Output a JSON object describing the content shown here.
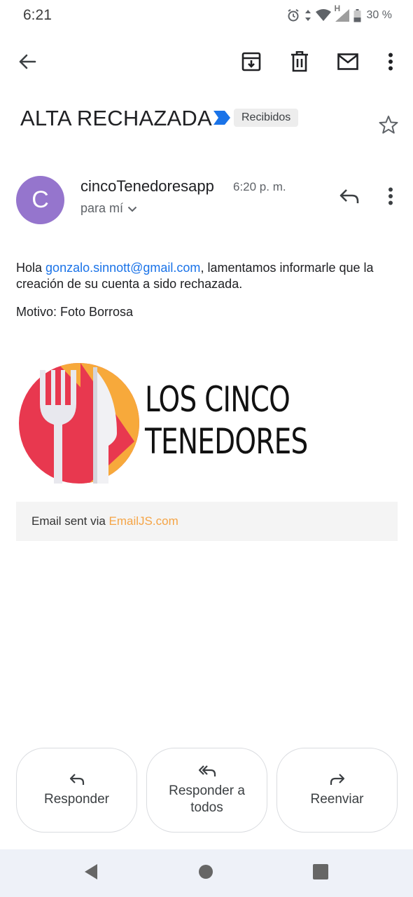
{
  "status_bar": {
    "time": "6:21",
    "network_label": "H",
    "battery_text": "30 %"
  },
  "app_bar": {
    "icons": [
      "back-arrow-icon",
      "archive-icon",
      "trash-icon",
      "mail-icon",
      "more-vert-icon"
    ]
  },
  "email": {
    "subject": "ALTA RECHAZADA",
    "label": "Recibidos",
    "sender": {
      "avatar_initial": "C",
      "avatar_color": "#9575cd",
      "name": "cincoTenedoresapp",
      "time": "6:20 p. m.",
      "recipient": "para mí"
    },
    "body": {
      "greeting": "Hola",
      "email_link": "gonzalo.sinnott@gmail.com",
      "message": ", lamentamos informarle que la creación de su cuenta a sido rechazada.",
      "reason": "Motivo: Foto Borrosa"
    },
    "logo": {
      "line1": "LOS CINCO",
      "line2": "TENEDORES"
    },
    "footer": {
      "text": "Email sent via ",
      "link": "EmailJS.com"
    }
  },
  "actions": {
    "reply": "Responder",
    "reply_all": "Responder a todos",
    "forward": "Reenviar"
  },
  "colors": {
    "link": "#1a73e8",
    "footer_link": "#f5a445",
    "importance_marker": "#1a73e8"
  }
}
